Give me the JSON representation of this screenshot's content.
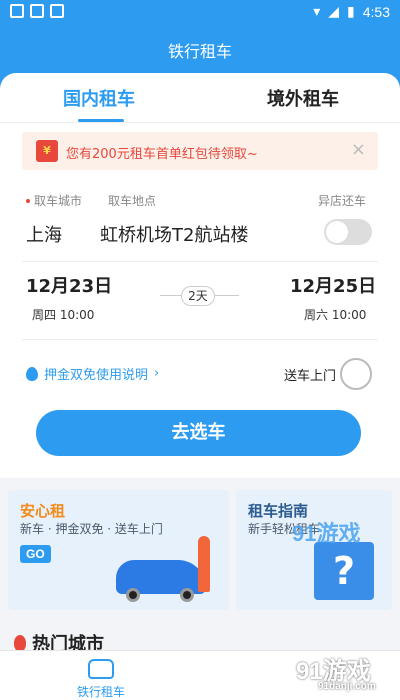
{
  "status_bar": {
    "time": "4:53"
  },
  "app_bar": {
    "title": "铁行租车"
  },
  "tabs": {
    "domestic": "国内租车",
    "overseas": "境外租车"
  },
  "promo": {
    "text": "您有200元租车首单红包待领取~",
    "close": "×"
  },
  "pickup": {
    "city_label": "取车城市",
    "location_label": "取车地点",
    "diff_return_label": "异店还车",
    "city": "上海",
    "location": "虹桥机场T2航站楼"
  },
  "dates": {
    "start_date": "12月23日",
    "start_day": "周四  10:00",
    "duration": "2天",
    "end_date": "12月25日",
    "end_day": "周六  10:00"
  },
  "options": {
    "deposit_text": "押金双免使用说明",
    "deposit_chevron": "›",
    "delivery_label": "送车上门"
  },
  "cta": {
    "label": "去选车"
  },
  "feature_safe": {
    "title": "安心租",
    "subtitle": "新车 · 押金双免 · 送车上门",
    "go": "GO"
  },
  "feature_guide": {
    "title": "租车指南",
    "subtitle": "新手轻松租车",
    "question": "?"
  },
  "hot_cities": {
    "title": "热门城市"
  },
  "bottom_nav": {
    "item_label": "铁行租车"
  },
  "watermark": {
    "text": "91游戏",
    "site": "91danji.com"
  },
  "colors": {
    "primary": "#2d9cf0",
    "promo_text": "#e8473c",
    "promo_bg": "#fdf0e8"
  }
}
